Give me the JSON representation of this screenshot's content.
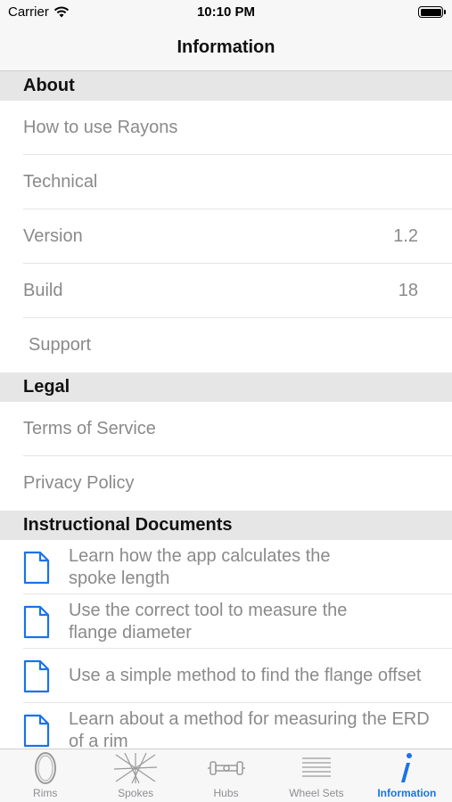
{
  "status": {
    "carrier": "Carrier",
    "time": "10:10 PM"
  },
  "nav": {
    "title": "Information"
  },
  "sections": {
    "about": {
      "title": "About",
      "items": [
        {
          "label": "How to use Rayons"
        },
        {
          "label": "Technical"
        },
        {
          "label": "Version",
          "value": "1.2"
        },
        {
          "label": "Build",
          "value": "18"
        },
        {
          "label": "Support"
        }
      ]
    },
    "legal": {
      "title": "Legal",
      "items": [
        {
          "label": "Terms of Service"
        },
        {
          "label": "Privacy Policy"
        }
      ]
    },
    "docs": {
      "title": "Instructional Documents",
      "items": [
        {
          "line1": "Learn how the app calculates the",
          "line2": "spoke length"
        },
        {
          "line1": "Use the correct tool to measure the",
          "line2": "flange diameter"
        },
        {
          "line1": "Use a simple method to find the flange offset",
          "line2": ""
        },
        {
          "line1": "Learn about a method for measuring the ERD",
          "line2": "of a rim"
        }
      ]
    }
  },
  "tabs": [
    {
      "label": "Rims",
      "icon": "rim-icon"
    },
    {
      "label": "Spokes",
      "icon": "spokes-icon"
    },
    {
      "label": "Hubs",
      "icon": "hub-icon"
    },
    {
      "label": "Wheel Sets",
      "icon": "wheel-sets-icon"
    },
    {
      "label": "Information",
      "icon": "info-icon",
      "active": true
    }
  ],
  "colors": {
    "accent": "#1a73e8",
    "muted": "#8a8a8a",
    "section_bg": "#e6e6e6"
  }
}
